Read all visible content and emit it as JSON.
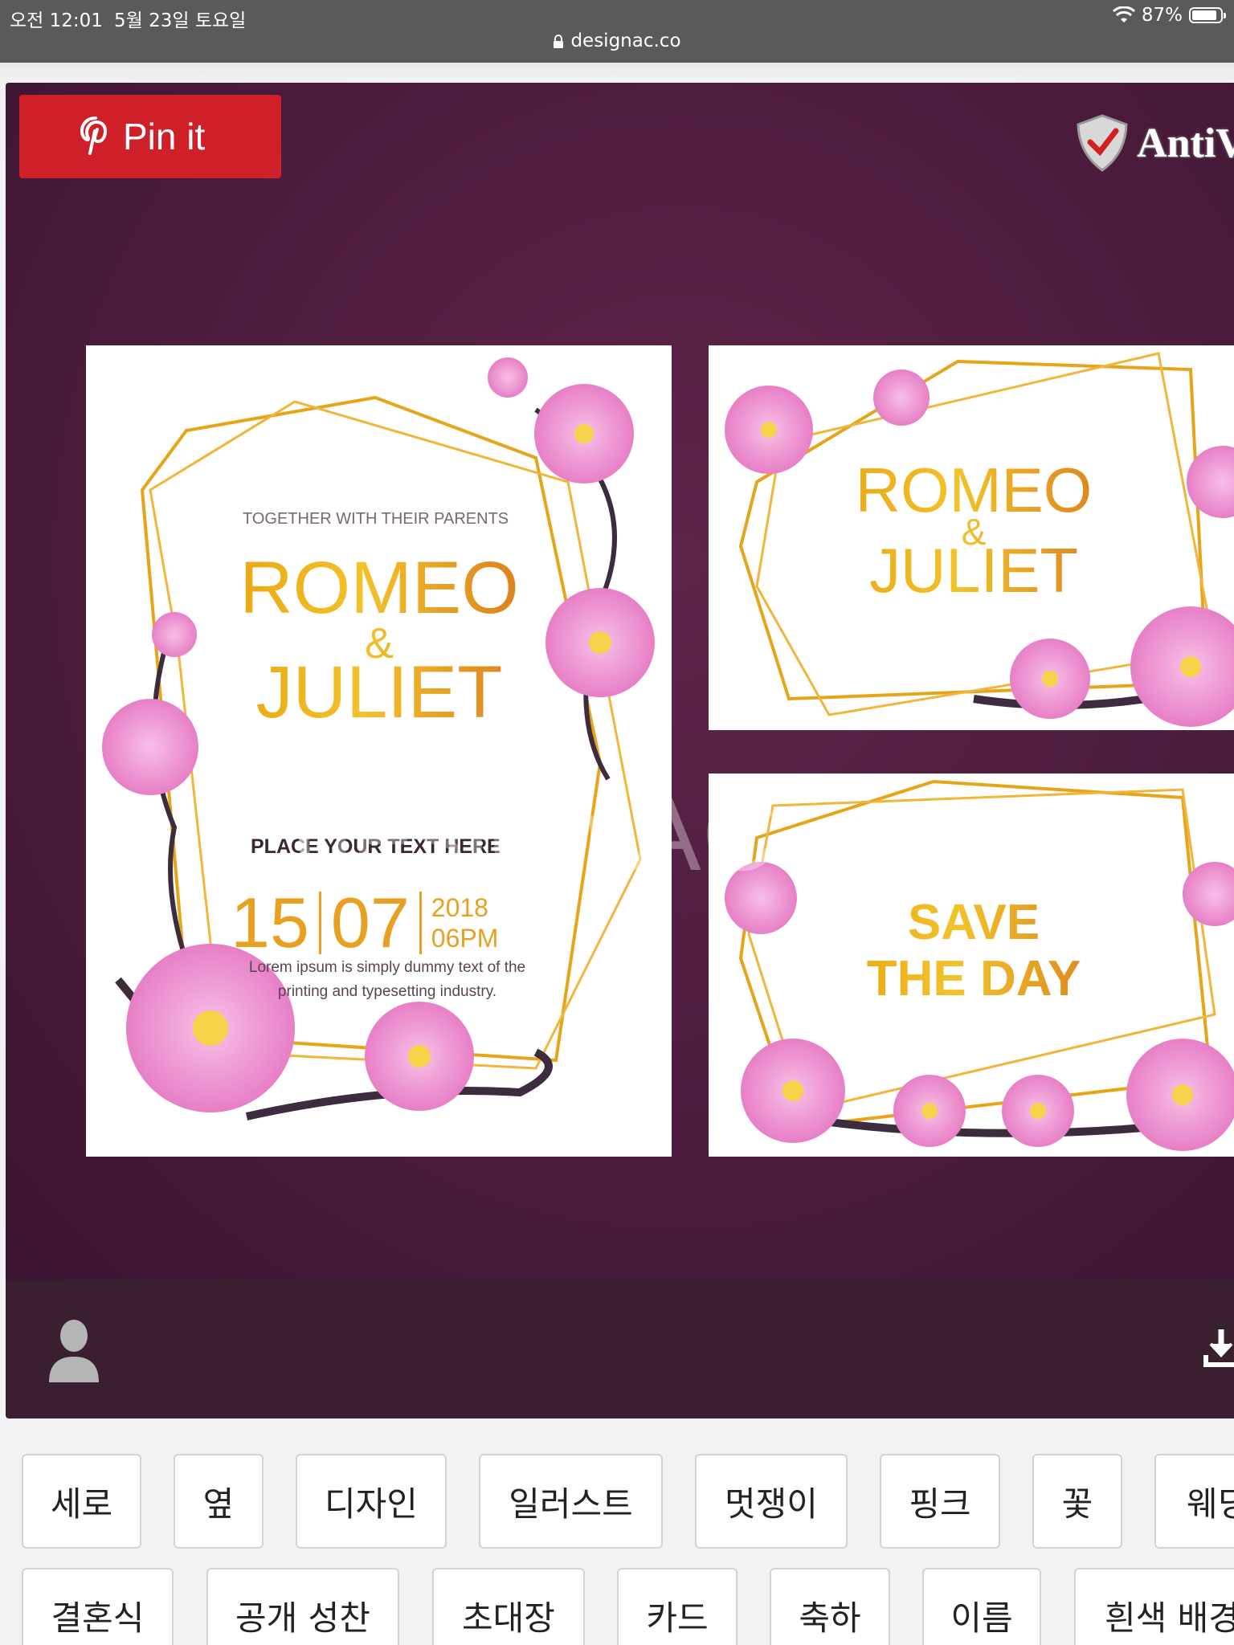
{
  "status_bar": {
    "time": "오전 12:01",
    "date": "5월 23일 토요일",
    "battery": "87%",
    "url": "designac.co",
    "icons": [
      "wifi-icon",
      "battery-icon",
      "lock-icon"
    ]
  },
  "preview": {
    "pin_button": "Pin it",
    "antivirus_badge": "AntiV",
    "watermark": "design AC",
    "invitation": {
      "tagline": "TOGETHER WITH THEIR PARENTS",
      "name1": "ROMEO",
      "amp": "&",
      "name2": "JULIET",
      "place_text": "PLACE YOUR TEXT HERE",
      "day": "15",
      "month": "07",
      "year": "2018",
      "time": "06PM",
      "lorem_line1": "Lorem ipsum is simply dummy text of the",
      "lorem_line2": "printing and typesetting industry."
    },
    "card_top": {
      "name1": "ROMEO",
      "amp": "&",
      "name2": "JULIET"
    },
    "card_bottom": {
      "line1": "SAVE",
      "line2": "THE DAY"
    },
    "colors": {
      "pin": "#cf1f28",
      "background": "#4d1c3d",
      "gold": "#e9a10f",
      "flower": "#f29bd3"
    }
  },
  "tags": {
    "row1": [
      "세로",
      "옆",
      "디자인",
      "일러스트",
      "멋쟁이",
      "핑크",
      "꽃",
      "웨딩"
    ],
    "row2": [
      "결혼식",
      "공개 성찬",
      "초대장",
      "카드",
      "축하",
      "이름",
      "흰색 배경"
    ]
  }
}
